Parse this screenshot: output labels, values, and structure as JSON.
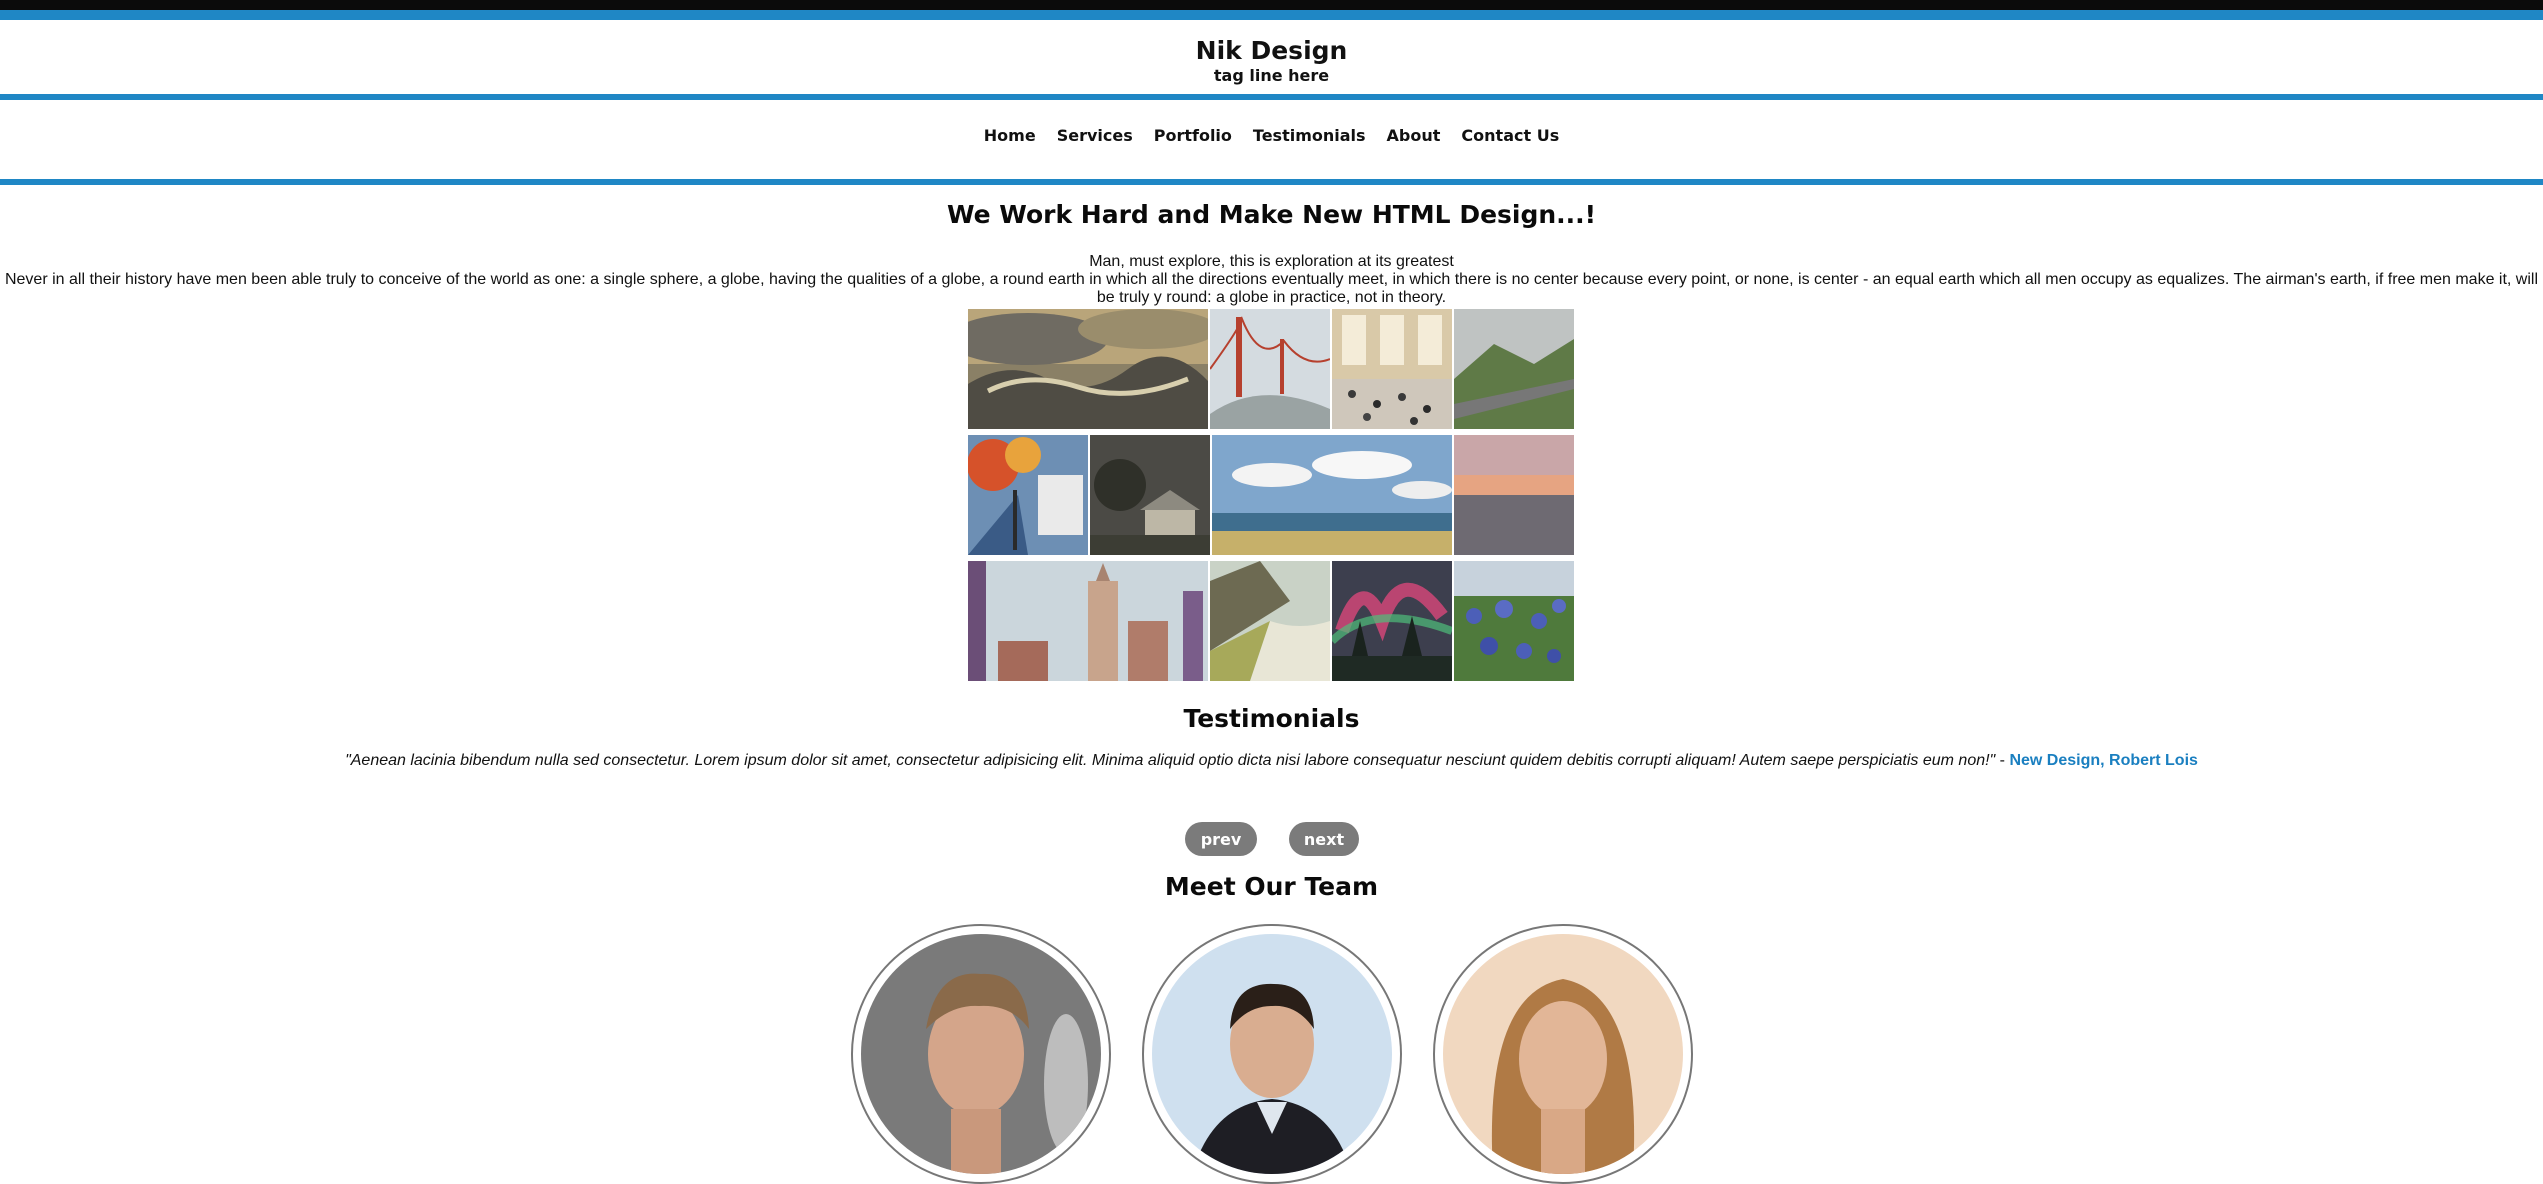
{
  "header": {
    "site_title": "Nik Design",
    "tagline": "tag line here"
  },
  "nav": {
    "items": [
      "Home",
      "Services",
      "Portfolio",
      "Testimonials",
      "About",
      "Contact Us"
    ]
  },
  "hero": {
    "headline": "We Work Hard and Make New HTML Design...!",
    "lead": "Man, must explore, this is exploration at its greatest",
    "body": "Never in all their history have men been able truly to conceive of the world as one: a single sphere, a globe, having the qualities of a globe, a round earth in which all the directions eventually meet, in which there is no center because every point, or none, is center - an equal earth which all men occupy as equalizes. The airman's earth, if free men make it, will be truly y round: a globe in practice, not in theory."
  },
  "gallery": {
    "images": [
      "stormy-sea-painting",
      "golden-gate-bridge-fog",
      "grand-central-crowd",
      "mountain-road",
      "autumn-street-painting",
      "chapel-at-dusk",
      "seaside-clouds",
      "sunset-sea",
      "city-skyline",
      "coastal-cliffs",
      "aurora-forest",
      "bluebell-flowers"
    ]
  },
  "testimonials": {
    "title": "Testimonials",
    "quote": "\"Aenean lacinia bibendum nulla sed consectetur. Lorem ipsum dolor sit amet, consectetur adipisicing elit. Minima aliquid optio dicta nisi labore consequatur nesciunt quidem debitis corrupti aliquam! Autem saepe perspiciatis eum non!\"",
    "separator": " - ",
    "author": "New Design, Robert Lois",
    "prev_label": "prev",
    "next_label": "next"
  },
  "team": {
    "title": "Meet Our Team",
    "members": [
      "team-member-1",
      "team-member-2",
      "team-member-3"
    ]
  },
  "colors": {
    "accent": "#1f87c5",
    "top_bar": "#0b0b0b",
    "button": "#7b7b7b",
    "author_link": "#1a7fc0"
  }
}
